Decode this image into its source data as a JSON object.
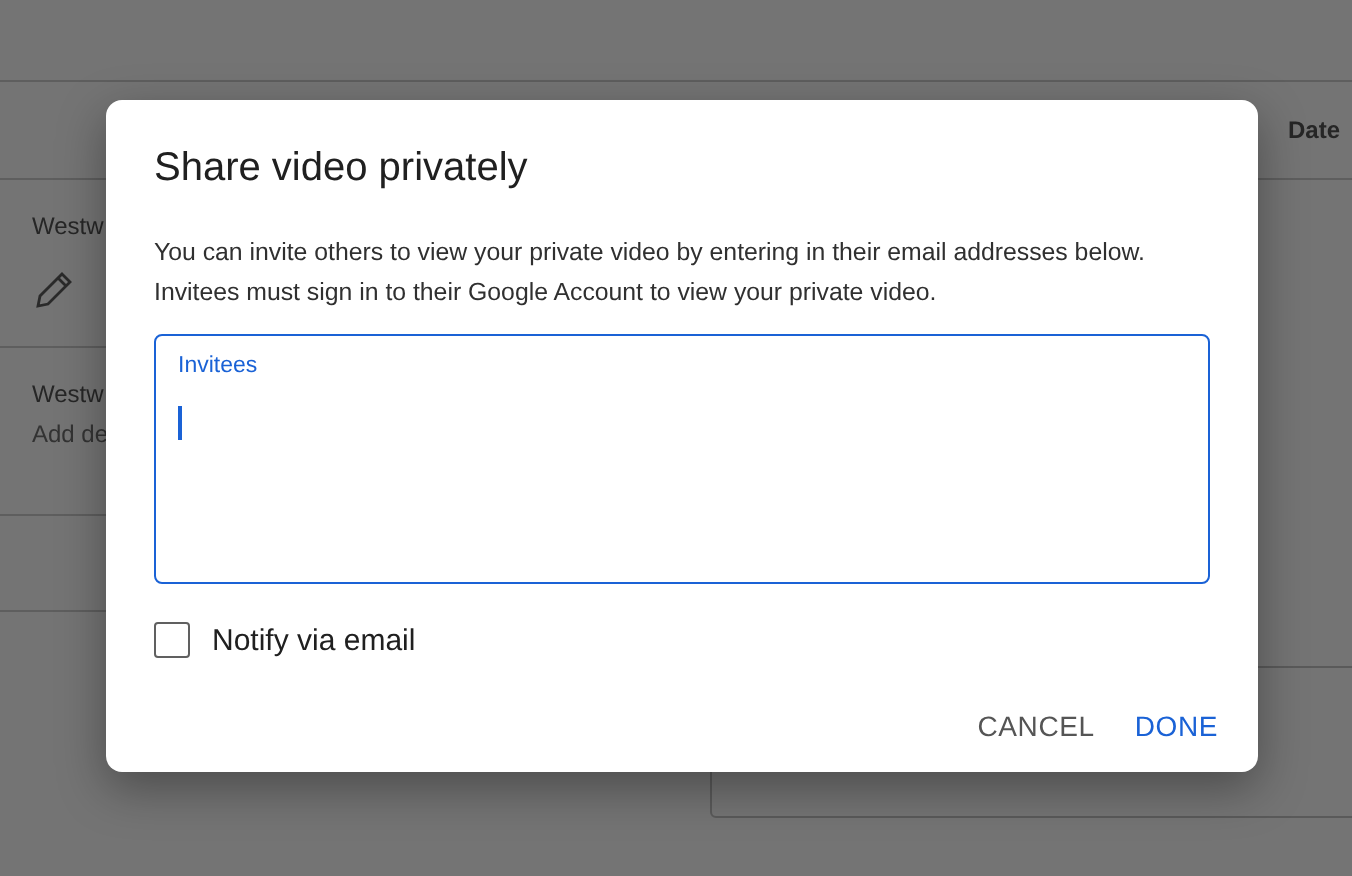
{
  "page": {
    "column_header": "Date",
    "rows": [
      {
        "title": "Westw",
        "kind": "edit"
      },
      {
        "title": "Westw",
        "description": "Add de",
        "kind": "text"
      }
    ]
  },
  "dialog": {
    "title": "Share video privately",
    "message": "You can invite others to view your private video by entering in their email addresses below. Invitees must sign in to their Google Account to view your private video.",
    "field": {
      "label": "Invitees"
    },
    "checkbox": {
      "label": "Notify via email",
      "checked": false
    },
    "buttons": [
      {
        "label": "CANCEL",
        "kind": "secondary"
      },
      {
        "label": "DONE",
        "kind": "primary"
      }
    ]
  }
}
